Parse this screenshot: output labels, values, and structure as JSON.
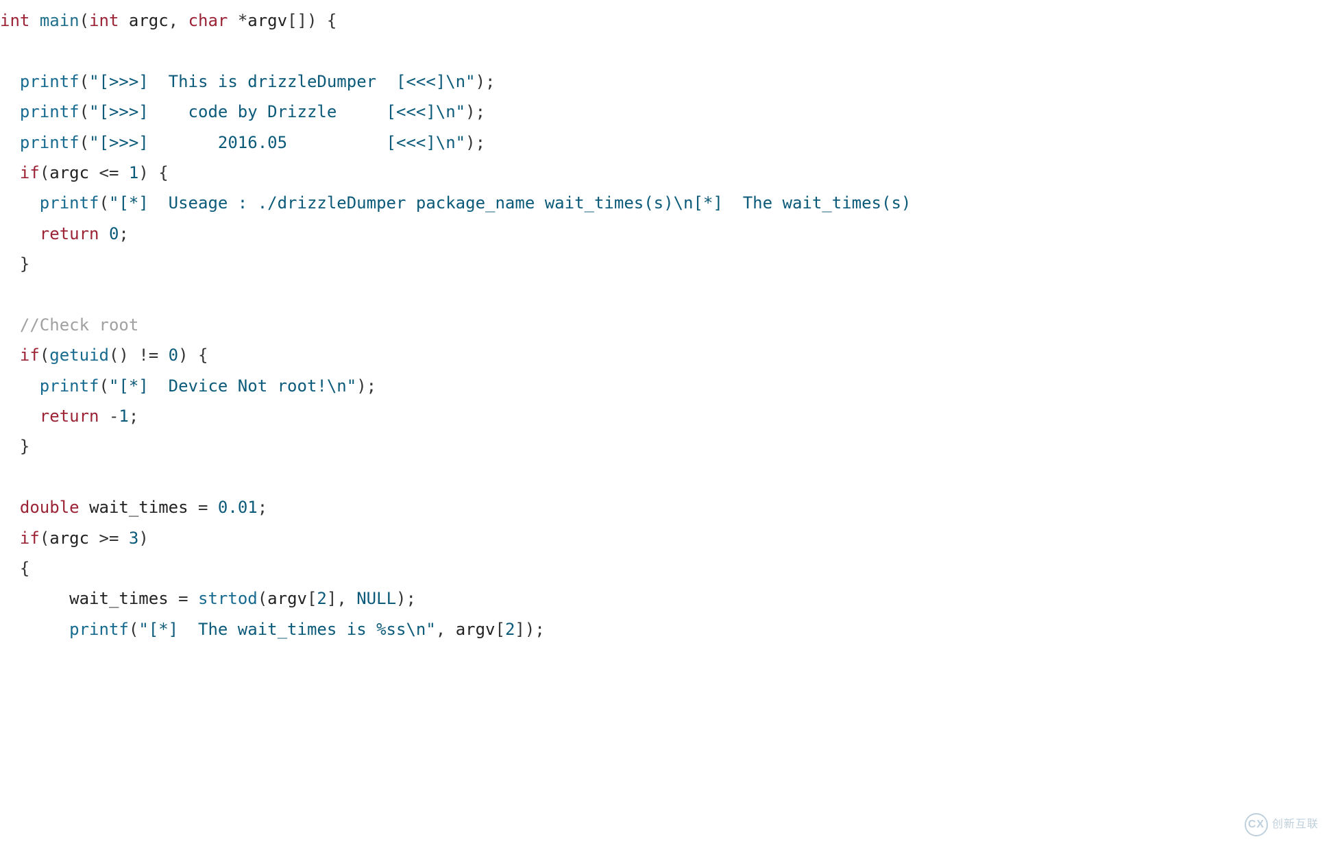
{
  "code": {
    "l1": {
      "kw_int": "int",
      "main": "main",
      "lp": "(",
      "kw_int2": "int",
      "argc": "argc",
      "comma": ", ",
      "kw_char": "char",
      "star": " *",
      "argv": "argv",
      "brk": "[]",
      "rp": ")",
      "sp": " ",
      "lb": "{"
    },
    "l3": {
      "printf": "printf",
      "lp": "(",
      "str": "\"[>>>]  This is drizzleDumper  [<<<]\\n\"",
      "rp": ")",
      "sc": ";"
    },
    "l4": {
      "printf": "printf",
      "lp": "(",
      "str": "\"[>>>]    code by Drizzle     [<<<]\\n\"",
      "rp": ")",
      "sc": ";"
    },
    "l5": {
      "printf": "printf",
      "lp": "(",
      "str": "\"[>>>]       2016.05          [<<<]\\n\"",
      "rp": ")",
      "sc": ";"
    },
    "l6": {
      "kw_if": "if",
      "lp": "(",
      "argc": "argc",
      "op": " <= ",
      "num": "1",
      "rp": ")",
      "sp": " ",
      "lb": "{"
    },
    "l7": {
      "printf": "printf",
      "lp": "(",
      "str": "\"[*]  Useage : ./drizzleDumper package_name wait_times(s)\\n[*]  The wait_times(s) ",
      "rp": ""
    },
    "l8": {
      "kw_return": "return",
      "sp": " ",
      "num": "0",
      "sc": ";"
    },
    "l9": {
      "rb": "}"
    },
    "l11": {
      "comment": "//Check root"
    },
    "l12": {
      "kw_if": "if",
      "lp": "(",
      "getuid": "getuid",
      "lp2": "(",
      "rp2": ")",
      "op": " != ",
      "num": "0",
      "rp": ")",
      "sp": " ",
      "lb": "{"
    },
    "l13": {
      "printf": "printf",
      "lp": "(",
      "str": "\"[*]  Device Not root!\\n\"",
      "rp": ")",
      "sc": ";"
    },
    "l14": {
      "kw_return": "return",
      "sp": " ",
      "neg": "-",
      "num": "1",
      "sc": ";"
    },
    "l15": {
      "rb": "}"
    },
    "l17": {
      "kw_double": "double",
      "sp": " ",
      "wait_times": "wait_times",
      "eq": " = ",
      "num": "0.01",
      "sc": ";"
    },
    "l18": {
      "kw_if": "if",
      "lp": "(",
      "argc": "argc",
      "op": " >= ",
      "num": "3",
      "rp": ")"
    },
    "l19": {
      "lb": "{"
    },
    "l20": {
      "wait_times": "wait_times",
      "eq": " = ",
      "strtod": "strtod",
      "lp": "(",
      "argv": "argv",
      "lb": "[",
      "num": "2",
      "rb": "]",
      "comma": ", ",
      "null": "NULL",
      "rp": ")",
      "sc": ";"
    },
    "l21": {
      "printf": "printf",
      "lp": "(",
      "str": "\"[*]  The wait_times is %ss\\n\"",
      "comma": ", ",
      "argv": "argv",
      "lb": "[",
      "num": "2",
      "rb": "]",
      "rp": ")",
      "sc": ";"
    }
  },
  "watermark": {
    "brand": "创新互联",
    "logo": "CX"
  }
}
